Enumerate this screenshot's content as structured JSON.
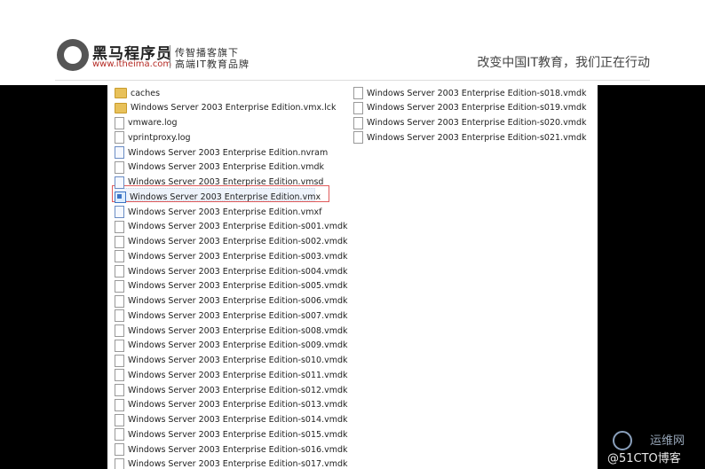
{
  "header": {
    "brand": "黑马程序员",
    "url": "www.itheima.com",
    "sub1": "传智播客旗下",
    "sub2": "高端IT教育品牌",
    "slogan": "改变中国IT教育，我们正在行动"
  },
  "files_left": [
    {
      "name": "caches",
      "icon": "folder-icon"
    },
    {
      "name": "Windows Server 2003 Enterprise Edition.vmx.lck",
      "icon": "folder-icon"
    },
    {
      "name": "vmware.log",
      "icon": "file-icon"
    },
    {
      "name": "vprintproxy.log",
      "icon": "file-icon"
    },
    {
      "name": "Windows Server 2003 Enterprise Edition.nvram",
      "icon": "doc-icon"
    },
    {
      "name": "Windows Server 2003 Enterprise Edition.vmdk",
      "icon": "file-icon"
    },
    {
      "name": "Windows Server 2003 Enterprise Edition.vmsd",
      "icon": "doc-icon"
    },
    {
      "name": "Windows Server 2003 Enterprise Edition.vmx",
      "icon": "vm-icon"
    },
    {
      "name": "Windows Server 2003 Enterprise Edition.vmxf",
      "icon": "doc-icon"
    },
    {
      "name": "Windows Server 2003 Enterprise Edition-s001.vmdk",
      "icon": "file-icon"
    },
    {
      "name": "Windows Server 2003 Enterprise Edition-s002.vmdk",
      "icon": "file-icon"
    },
    {
      "name": "Windows Server 2003 Enterprise Edition-s003.vmdk",
      "icon": "file-icon"
    },
    {
      "name": "Windows Server 2003 Enterprise Edition-s004.vmdk",
      "icon": "file-icon"
    },
    {
      "name": "Windows Server 2003 Enterprise Edition-s005.vmdk",
      "icon": "file-icon"
    },
    {
      "name": "Windows Server 2003 Enterprise Edition-s006.vmdk",
      "icon": "file-icon"
    },
    {
      "name": "Windows Server 2003 Enterprise Edition-s007.vmdk",
      "icon": "file-icon"
    },
    {
      "name": "Windows Server 2003 Enterprise Edition-s008.vmdk",
      "icon": "file-icon"
    },
    {
      "name": "Windows Server 2003 Enterprise Edition-s009.vmdk",
      "icon": "file-icon"
    },
    {
      "name": "Windows Server 2003 Enterprise Edition-s010.vmdk",
      "icon": "file-icon"
    },
    {
      "name": "Windows Server 2003 Enterprise Edition-s011.vmdk",
      "icon": "file-icon"
    },
    {
      "name": "Windows Server 2003 Enterprise Edition-s012.vmdk",
      "icon": "file-icon"
    },
    {
      "name": "Windows Server 2003 Enterprise Edition-s013.vmdk",
      "icon": "file-icon"
    },
    {
      "name": "Windows Server 2003 Enterprise Edition-s014.vmdk",
      "icon": "file-icon"
    },
    {
      "name": "Windows Server 2003 Enterprise Edition-s015.vmdk",
      "icon": "file-icon"
    },
    {
      "name": "Windows Server 2003 Enterprise Edition-s016.vmdk",
      "icon": "file-icon"
    },
    {
      "name": "Windows Server 2003 Enterprise Edition-s017.vmdk",
      "icon": "file-icon"
    }
  ],
  "files_right": [
    {
      "name": "Windows Server 2003 Enterprise Edition-s018.vmdk",
      "icon": "file-icon"
    },
    {
      "name": "Windows Server 2003 Enterprise Edition-s019.vmdk",
      "icon": "file-icon"
    },
    {
      "name": "Windows Server 2003 Enterprise Edition-s020.vmdk",
      "icon": "file-icon"
    },
    {
      "name": "Windows Server 2003 Enterprise Edition-s021.vmdk",
      "icon": "file-icon"
    }
  ],
  "watermark": {
    "top": "运维网",
    "bottom": "@51CTO博客"
  }
}
